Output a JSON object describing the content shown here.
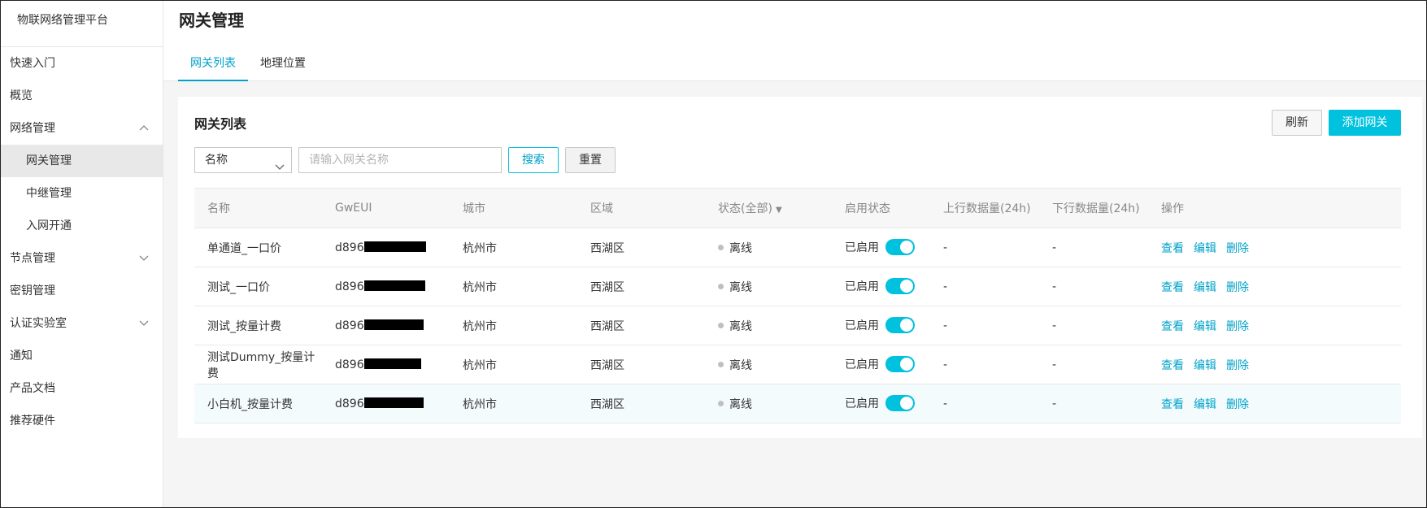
{
  "sidebar": {
    "brand": "物联网络管理平台",
    "items": [
      {
        "label": "快速入门"
      },
      {
        "label": "概览"
      },
      {
        "label": "网络管理"
      },
      {
        "label": "网关管理"
      },
      {
        "label": "中继管理"
      },
      {
        "label": "入网开通"
      },
      {
        "label": "节点管理"
      },
      {
        "label": "密钥管理"
      },
      {
        "label": "认证实验室"
      },
      {
        "label": "通知"
      },
      {
        "label": "产品文档"
      },
      {
        "label": "推荐硬件"
      }
    ]
  },
  "header": {
    "title": "网关管理",
    "tabs": [
      {
        "label": "网关列表"
      },
      {
        "label": "地理位置"
      }
    ]
  },
  "card": {
    "title": "网关列表",
    "refresh_label": "刷新",
    "add_label": "添加网关",
    "filter_select": "名称",
    "search_placeholder": "请输入网关名称",
    "search_label": "搜索",
    "reset_label": "重置"
  },
  "table": {
    "columns": [
      "名称",
      "GwEUI",
      "城市",
      "区域",
      "状态(全部)",
      "启用状态",
      "上行数据量(24h)",
      "下行数据量(24h)",
      "操作"
    ],
    "rows": [
      {
        "name": "单通道_一口价",
        "gweui": "d896",
        "city": "杭州市",
        "district": "西湖区",
        "status": "离线",
        "enabled": "已启用",
        "up": "-",
        "down": "-"
      },
      {
        "name": "测试_一口价",
        "gweui": "d896",
        "city": "杭州市",
        "district": "西湖区",
        "status": "离线",
        "enabled": "已启用",
        "up": "-",
        "down": "-"
      },
      {
        "name": "测试_按量计费",
        "gweui": "d896",
        "city": "杭州市",
        "district": "西湖区",
        "status": "离线",
        "enabled": "已启用",
        "up": "-",
        "down": "-"
      },
      {
        "name": "测试Dummy_按量计费",
        "gweui": "d896",
        "city": "杭州市",
        "district": "西湖区",
        "status": "离线",
        "enabled": "已启用",
        "up": "-",
        "down": "-"
      },
      {
        "name": "小白机_按量计费",
        "gweui": "d896",
        "city": "杭州市",
        "district": "西湖区",
        "status": "离线",
        "enabled": "已启用",
        "up": "-",
        "down": "-"
      }
    ],
    "actions": {
      "view": "查看",
      "edit": "编辑",
      "delete": "删除"
    }
  },
  "colors": {
    "accent": "#00c1de",
    "link": "#00a2ca",
    "offline_dot": "#bfbfbf"
  }
}
